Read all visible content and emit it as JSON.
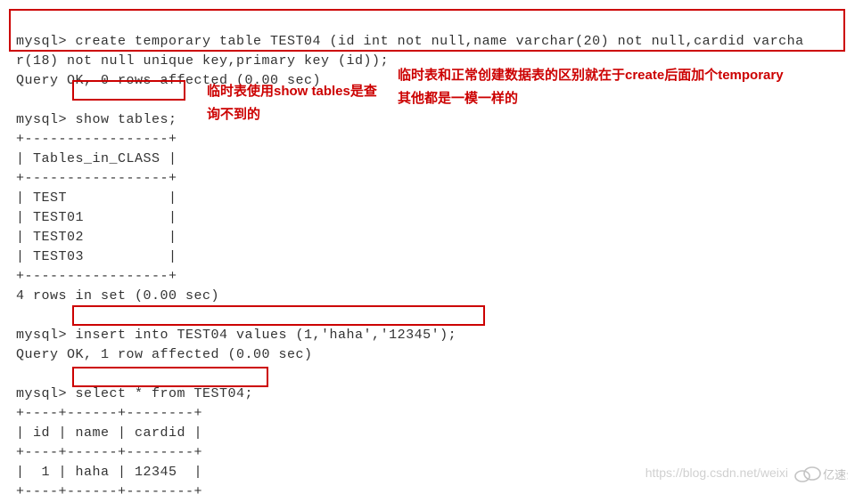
{
  "terminal": {
    "prompt": "mysql>",
    "create_stmt_line1": "mysql> create temporary table TEST04 (id int not null,name varchar(20) not null,cardid varcha",
    "create_stmt_line2": "r(18) not null unique key,primary key (id));",
    "create_result": "Query OK, 0 rows affected (0.00 sec)",
    "show_stmt": "mysql> show tables;",
    "table_border": "+-----------------+",
    "table_header": "| Tables_in_CLASS |",
    "table_rows": [
      "| TEST            |",
      "| TEST01          |",
      "| TEST02          |",
      "| TEST03          |"
    ],
    "show_result": "4 rows in set (0.00 sec)",
    "insert_stmt": "mysql> insert into TEST04 values (1,'haha','12345');",
    "insert_result": "Query OK, 1 row affected (0.00 sec)",
    "select_stmt": "mysql> select * from TEST04;",
    "select_border": "+----+------+--------+",
    "select_header": "| id | name | cardid |",
    "select_row": "|  1 | haha | 12345  |"
  },
  "annotations": {
    "show_tables_note": "临时表使用show tables是查询不到的",
    "temporary_note_line1": "临时表和正常创建数据表的区别就在于create后面加个temporary",
    "temporary_note_line2": "其他都是一模一样的"
  },
  "watermark": {
    "url": "https://blog.csdn.net/weixi",
    "brand": "亿速云"
  },
  "chart_data": {
    "type": "table",
    "tables": [
      {
        "title": "Tables_in_CLASS",
        "columns": [
          "Tables_in_CLASS"
        ],
        "rows": [
          [
            "TEST"
          ],
          [
            "TEST01"
          ],
          [
            "TEST02"
          ],
          [
            "TEST03"
          ]
        ]
      },
      {
        "title": "TEST04",
        "columns": [
          "id",
          "name",
          "cardid"
        ],
        "rows": [
          [
            1,
            "haha",
            "12345"
          ]
        ]
      }
    ]
  }
}
